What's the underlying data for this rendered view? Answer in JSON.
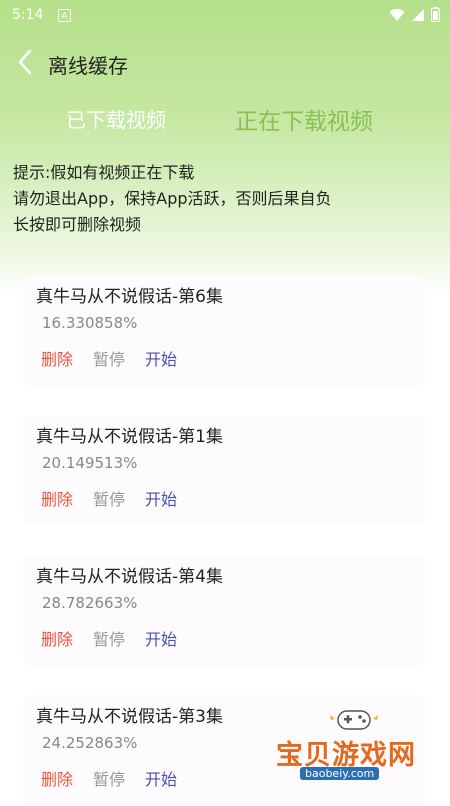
{
  "status_bar": {
    "time": "5:14",
    "notification_letter": "A"
  },
  "header": {
    "title": "离线缓存"
  },
  "tabs": {
    "downloaded": "已下载视频",
    "downloading": "正在下载视频"
  },
  "tips": {
    "line1": "提示:假如有视频正在下载",
    "line2": "请勿退出App，保持App活跃，否则后果自负",
    "line3": "长按即可删除视频"
  },
  "items": [
    {
      "title": "真牛马从不说假话-第6集",
      "progress": "16.330858%",
      "delete": "删除",
      "pause": "暂停",
      "start": "开始"
    },
    {
      "title": "真牛马从不说假话-第1集",
      "progress": "20.149513%",
      "delete": "删除",
      "pause": "暂停",
      "start": "开始"
    },
    {
      "title": "真牛马从不说假话-第4集",
      "progress": "28.782663%",
      "delete": "删除",
      "pause": "暂停",
      "start": "开始"
    },
    {
      "title": "真牛马从不说假话-第3集",
      "progress": "24.252863%",
      "delete": "删除",
      "pause": "暂停",
      "start": "开始"
    }
  ],
  "watermark": {
    "name": "宝贝游戏网",
    "url": "baobeiy.com"
  },
  "colors": {
    "accent": "#8abf52",
    "delete": "#e8553d",
    "pause": "#999999",
    "start": "#4a52a8"
  }
}
